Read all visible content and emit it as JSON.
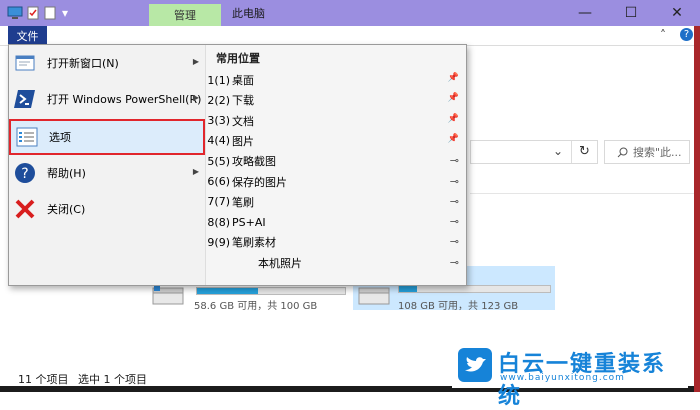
{
  "titlebar": {
    "tab_manage": "管理",
    "title": "此电脑",
    "minimize": "—",
    "maximize": "☐",
    "close": "✕",
    "quick_access": [
      "▾"
    ]
  },
  "ribbon": {
    "file_tab": "文件",
    "collapse": "˄",
    "help": "?"
  },
  "address": {
    "refresh": "↻",
    "dropdown": "⌄",
    "search_placeholder": "搜索\"此..."
  },
  "file_menu": {
    "items": [
      {
        "label": "打开新窗口(N)",
        "has_submenu": true,
        "icon": "new-window-icon"
      },
      {
        "label": "打开 Windows PowerShell(R)",
        "has_submenu": true,
        "icon": "powershell-icon"
      },
      {
        "label": "选项",
        "has_submenu": false,
        "icon": "options-icon",
        "highlighted": true
      },
      {
        "label": "帮助(H)",
        "has_submenu": true,
        "icon": "help-icon"
      },
      {
        "label": "关闭(C)",
        "has_submenu": false,
        "icon": "close-icon"
      }
    ],
    "recent_title": "常用位置",
    "recent": [
      {
        "num": "1",
        "label": "桌面",
        "pinned": true
      },
      {
        "num": "2",
        "label": "下载",
        "pinned": true
      },
      {
        "num": "3",
        "label": "文档",
        "pinned": true
      },
      {
        "num": "4",
        "label": "图片",
        "pinned": true
      },
      {
        "num": "5",
        "label": "攻略截图",
        "pinned": false
      },
      {
        "num": "6",
        "label": "保存的图片",
        "pinned": false
      },
      {
        "num": "7",
        "label": "笔刷",
        "pinned": false
      },
      {
        "num": "8",
        "label": "PS+AI",
        "pinned": false
      },
      {
        "num": "9",
        "label": "笔刷素材",
        "pinned": false
      },
      {
        "num": "",
        "label": "本机照片",
        "pinned": false
      }
    ]
  },
  "drives": [
    {
      "free_text": "58.6 GB 可用，共 100 GB",
      "used_fraction": 0.414
    },
    {
      "free_text": "108 GB 可用，共 123 GB",
      "used_fraction": 0.122
    }
  ],
  "statusbar": {
    "item_count": "11 个项目",
    "selected": "选中 1 个项目"
  },
  "brand": {
    "name": "白云一键重装系统",
    "url": "www.baiyunxitong.com"
  },
  "colors": {
    "titlebar": "#9b8ee0",
    "manage_tab": "#b8e8a6",
    "file_tab": "#1f3d8f",
    "highlight_border": "#e1262c",
    "brand": "#1683d8"
  }
}
